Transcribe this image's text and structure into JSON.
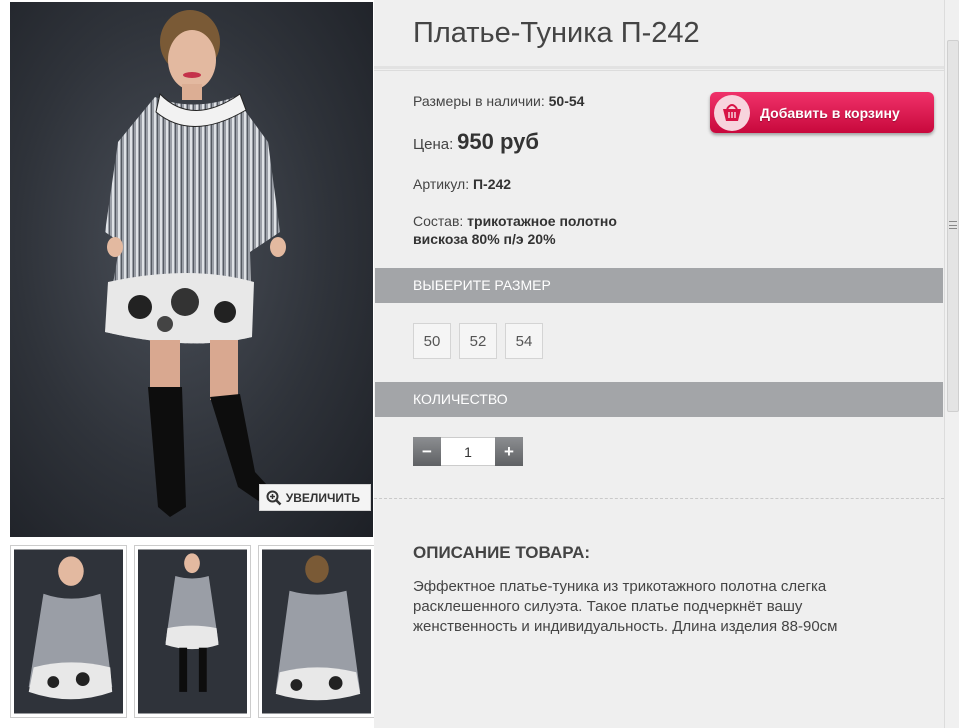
{
  "product": {
    "title": "Платье-Туника П-242",
    "sizes_label": "Размеры в наличии:",
    "sizes_value": "50-54",
    "price_label": "Цена:",
    "price_value": "950 руб",
    "article_label": "Артикул:",
    "article_value": "П-242",
    "composition_label": "Состав:",
    "composition_line1": "трикотажное полотно",
    "composition_line2": "вискоза 80% п/э 20%"
  },
  "cart": {
    "button_label": "Добавить в корзину",
    "icon": "basket-icon"
  },
  "gallery": {
    "zoom_label": "УВЕЛИЧИТЬ",
    "thumbnails": [
      "thumb-front-closeup",
      "thumb-full-length",
      "thumb-back-view"
    ]
  },
  "size_select": {
    "header": "ВЫБЕРИТЕ РАЗМЕР",
    "options": [
      "50",
      "52",
      "54"
    ]
  },
  "quantity": {
    "header": "КОЛИЧЕСТВО",
    "minus": "−",
    "value": "1",
    "plus": "+"
  },
  "description": {
    "title": "ОПИСАНИЕ ТОВАРА:",
    "text": "Эффектное платье-туника из трикотажного полотна слегка расклешенного силуэта. Такое платье подчеркнёт вашу женственность и индивидуальность. Длина изделия 88-90см"
  },
  "colors": {
    "accent": "#e0144c",
    "section_bar": "#a3a5a8",
    "panel_bg": "#efefef"
  }
}
